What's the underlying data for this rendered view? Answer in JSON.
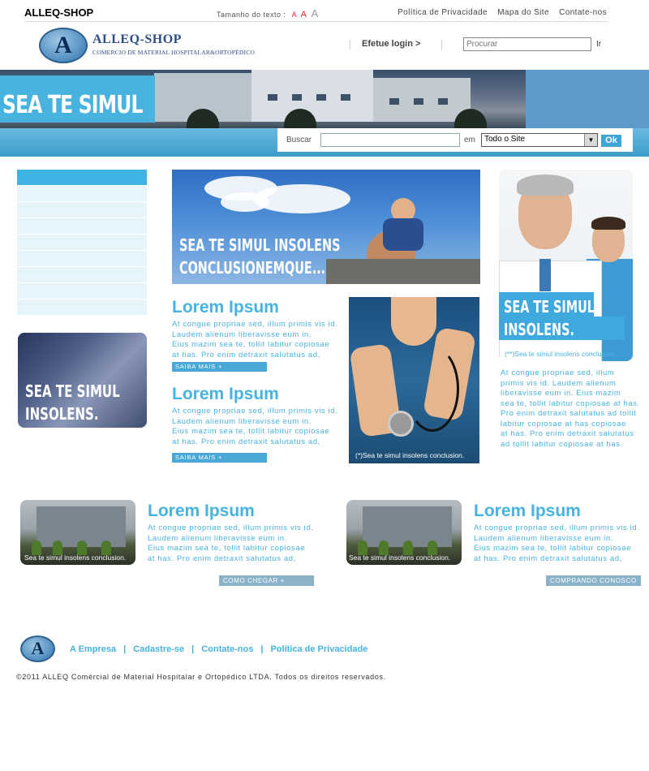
{
  "header": {
    "brand": "ALLEQ-SHOP",
    "text_size_label": "Tamanho do texto :",
    "text_size_options": [
      "A",
      "A",
      "A"
    ],
    "links": [
      "Política de Privacidade",
      "Mapa do Site",
      "Contate-nos"
    ],
    "logo_name": "ALLEQ-SHOP",
    "logo_subtitle": "COMERCIO DE MATERIAL HOSPITALAR&ORTOPÉDICO",
    "logo_letter": "A",
    "login_label": "Efetue login >",
    "search_placeholder": "Procurar",
    "search_go": "Ir"
  },
  "banner": {
    "title": "SEA TE SIMUL"
  },
  "search_bar": {
    "label": "Buscar",
    "in_label": "em",
    "scope_value": "Todo o Site",
    "ok_label": "Ok"
  },
  "left_card": {
    "line1": "SEA TE SIMUL",
    "line2": "INSOLENS."
  },
  "hero": {
    "line1": "SEA TE SIMUL INSOLENS",
    "line2": "CONCLUSIONEMQUE..."
  },
  "blocks": [
    {
      "title": "Lorem Ipsum",
      "lines": [
        "At congue propriae sed, illum primis vis id.",
        "Laudem alienum liberavisse eum in.",
        "Eius mazim sea te, tollit labitur copiosae",
        "at has. Pro enim detraxit salutatus ad,"
      ],
      "button": "SAIBA MAIS +"
    },
    {
      "title": "Lorem Ipsum",
      "lines": [
        "At congue propriae sed, illum primis vis id.",
        "Laudem alienum liberavisse eum in.",
        "Eius mazim sea te, tollit labitur copiosae",
        "at has. Pro enim detraxit salutatus ad,"
      ],
      "button": "SAIBA MAIS +"
    }
  ],
  "nurse_caption": "(*)Sea te simul insolens conclusion.",
  "doctors": {
    "line1": "SEA TE SIMUL",
    "line2": "INSOLENS.",
    "caption": "(**)Sea te simul insolens conclusion."
  },
  "right_text": [
    "At congue propriae sed, illum",
    "primis vis id. Laudem alienum",
    "liberavisse eum in. Eius mazim",
    "sea te, tollit labitur copiosae at has.",
    "Pro enim detraxit salutatus ad tollit",
    "labitur copiosae at has copiosae",
    "at has. Pro enim detraxit salutatus",
    "ad tollit labitur copiosae at has."
  ],
  "bottom": [
    {
      "caption": "Sea te simul insolens conclusion.",
      "title": "Lorem Ipsum",
      "lines": [
        "At congue propriae sed, illum primis vis id.",
        "Laudem alienum liberavisse eum in.",
        "Eius mazim sea te, tollit labitur copiosae",
        "at has. Pro enim detraxit salutatus ad,"
      ],
      "button": "COMO CHEGAR +"
    },
    {
      "caption": "Sea te simul insolens conclusion.",
      "title": "Lorem Ipsum",
      "lines": [
        "At congue propriae sed, illum primis vis id.",
        "Laudem alienum liberavisse eum in.",
        "Eius mazim sea te, tollit labitur copiosae",
        "at has. Pro enim detraxit salutatus ad,"
      ],
      "button": "COMPRANDO CONOSCO +"
    }
  ],
  "footer": {
    "logo_letter": "A",
    "links": [
      "A Empresa",
      "Cadastre-se",
      "Contate-nos",
      "Política de Privacidade"
    ],
    "separator": "|",
    "copyright": "©2011 ALLEQ Comércial de Material Hospitalar e Ortopédico LTDA. Todos os direitos reservados."
  },
  "colors": {
    "accent": "#49b3df",
    "logo_text": "#2c4d86",
    "menu_light": "#e6f4fb"
  }
}
